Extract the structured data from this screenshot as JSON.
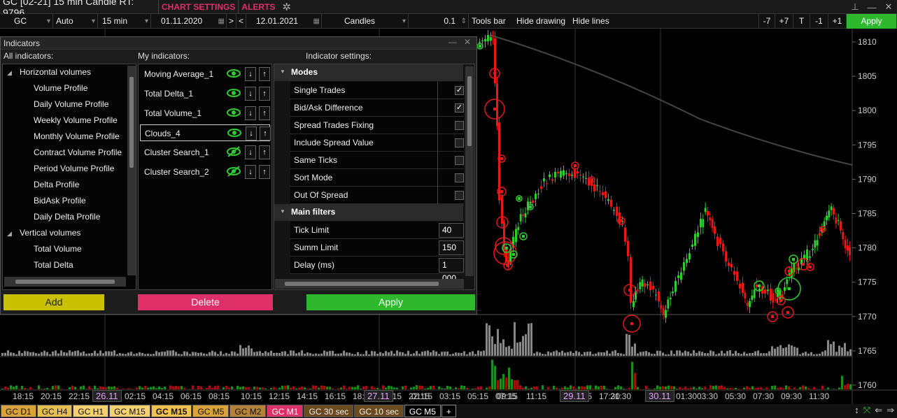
{
  "titlebar": {
    "title": "GC [02-21] 15 min Candle RT: 9796",
    "chart_settings": "CHART SETTINGS",
    "alerts": "ALERTS"
  },
  "toolbar": {
    "symbol": "GC",
    "scale": "Auto",
    "timeframe": "15 min",
    "date_from": "01.11.2020",
    "nav_next": ">",
    "nav_prev": "<",
    "date_to": "12.01.2021",
    "chart_type": "Candles",
    "tick_size": "0.1",
    "tools_bar": "Tools bar",
    "hide_drawing": "Hide drawing",
    "hide_lines": "Hide lines",
    "minus7": "-7",
    "plus7": "+7",
    "t": "T",
    "minus1": "-1",
    "plus1": "+1",
    "apply": "Apply"
  },
  "price_axis": [
    "1810",
    "1805",
    "1800",
    "1795",
    "1790",
    "1785",
    "1780",
    "1775",
    "1770",
    "1765",
    "1760"
  ],
  "time_axis": {
    "labels": [
      "18:15",
      "20:15",
      "22:15",
      "02:15",
      "04:15",
      "06:15",
      "08:15",
      "10:15",
      "12:15",
      "14:15",
      "16:15",
      "18:15",
      "20:15",
      "22:15",
      "01:15",
      "03:15",
      "05:15",
      "07:15",
      "09:15",
      "11:15",
      "13:15",
      "17:30",
      "21:30",
      "01:30",
      "03:30",
      "05:30",
      "07:30",
      "09:30",
      "11:30"
    ],
    "days": [
      "26.11",
      "27.11",
      "29.11",
      "30.11"
    ]
  },
  "tabs": [
    "GC D1",
    "GC H4",
    "GC H1",
    "GC M15",
    "GC M15",
    "GC M5",
    "GC M2",
    "GC M1",
    "GC 30 sec",
    "GC 10 sec",
    "GC M5",
    "+"
  ],
  "panel": {
    "title": "Indicators",
    "all_header": "All indicators:",
    "my_header": "My indicators:",
    "settings_header": "Indicator settings:",
    "all_items": [
      {
        "label": "Horizontal volumes",
        "group": true
      },
      {
        "label": "Volume Profile",
        "group": false
      },
      {
        "label": "Daily Volume Profile",
        "group": false
      },
      {
        "label": "Weekly Volume Profile",
        "group": false
      },
      {
        "label": "Monthly Volume Profile",
        "group": false
      },
      {
        "label": "Contract Volume Profile",
        "group": false
      },
      {
        "label": "Period Volume Profile",
        "group": false
      },
      {
        "label": "Delta Profile",
        "group": false
      },
      {
        "label": "BidAsk Profile",
        "group": false
      },
      {
        "label": "Daily Delta Profile",
        "group": false
      },
      {
        "label": "Vertical volumes",
        "group": true
      },
      {
        "label": "Total Volume",
        "group": false
      },
      {
        "label": "Total Delta",
        "group": false
      }
    ],
    "my_items": [
      {
        "label": "Moving Average_1",
        "visible": true
      },
      {
        "label": "Total Delta_1",
        "visible": true
      },
      {
        "label": "Total Volume_1",
        "visible": true
      },
      {
        "label": "Clouds_4",
        "visible": true
      },
      {
        "label": "Cluster Search_1",
        "visible": false
      },
      {
        "label": "Cluster Search_2",
        "visible": false
      }
    ],
    "down_arrow": "↓",
    "up_arrow": "↑",
    "modes_title": "Modes",
    "modes": [
      {
        "label": "Single Trades",
        "checked": true
      },
      {
        "label": "Bid/Ask Difference",
        "checked": true
      },
      {
        "label": "Spread Trades Fixing",
        "checked": false
      },
      {
        "label": "Include Spread Value",
        "checked": false
      },
      {
        "label": "Same Ticks",
        "checked": false
      },
      {
        "label": "Sort Mode",
        "checked": false
      },
      {
        "label": "Out Of Spread",
        "checked": false
      }
    ],
    "filters_title": "Main filters",
    "filters": [
      {
        "label": "Tick Limit",
        "value": "40"
      },
      {
        "label": "Summ Limit",
        "value": "150"
      },
      {
        "label": "Delay (ms)",
        "value": "1 000"
      }
    ],
    "add": "Add",
    "delete": "Delete",
    "apply": "Apply"
  },
  "colors": {
    "bull": "#2ecc2e",
    "bear": "#e81818",
    "apply_green": "#2eb82e",
    "add_yellow": "#c8c000",
    "delete_pink": "#e0306a"
  }
}
